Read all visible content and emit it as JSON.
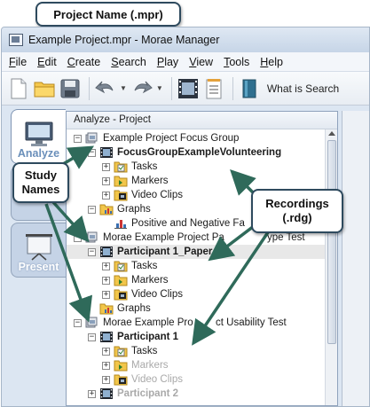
{
  "callouts": {
    "project_name": "Project Name (.mpr)",
    "study_names": [
      "Study",
      "Names"
    ],
    "recordings": [
      "Recordings",
      "(.rdg)"
    ]
  },
  "window": {
    "title": "Example Project.mpr - Morae Manager"
  },
  "menu": [
    "File",
    "Edit",
    "Create",
    "Search",
    "Play",
    "View",
    "Tools",
    "Help"
  ],
  "toolbar": {
    "icons": [
      "new-file-icon",
      "open-folder-icon",
      "save-icon",
      "undo-icon",
      "redo-icon",
      "video-icon",
      "notes-icon",
      "search-book-icon"
    ],
    "search_label": "What is Search"
  },
  "tabs": {
    "analyze": "Analyze",
    "present": "Present"
  },
  "panel": {
    "title": "Analyze - Project"
  },
  "tree": [
    {
      "label": "Example Project Focus Group",
      "type": "study",
      "expander": "−",
      "level": 0
    },
    {
      "label": "FocusGroupExampleVolunteering",
      "type": "recording",
      "expander": "−",
      "level": 1,
      "bold": true
    },
    {
      "label": "Tasks",
      "type": "tasks",
      "expander": "+",
      "level": 2
    },
    {
      "label": "Markers",
      "type": "markers",
      "expander": "+",
      "level": 2
    },
    {
      "label": "Video Clips",
      "type": "clips",
      "expander": "+",
      "level": 2
    },
    {
      "label": "Graphs",
      "type": "graphs",
      "expander": "−",
      "level": 1
    },
    {
      "label": "Positive and Negative Fa",
      "type": "graph",
      "expander": "",
      "level": 2
    },
    {
      "label": "Morae Example Project Pa",
      "type": "study",
      "expander": "−",
      "level": 0
    },
    {
      "label": "Participant 1_Paper",
      "type": "recording",
      "expander": "−",
      "level": 1,
      "bold": true,
      "selected": true
    },
    {
      "label": "Tasks",
      "type": "tasks",
      "expander": "+",
      "level": 2
    },
    {
      "label": "Markers",
      "type": "markers",
      "expander": "+",
      "level": 2
    },
    {
      "label": "Video Clips",
      "type": "clips",
      "expander": "+",
      "level": 2
    },
    {
      "label": "Graphs",
      "type": "graphs",
      "expander": "",
      "level": 1
    },
    {
      "label": "Morae Example Pro",
      "type": "study",
      "expander": "−",
      "level": 0
    },
    {
      "label": "Participant 1",
      "type": "recording",
      "expander": "−",
      "level": 1,
      "bold": true
    },
    {
      "label": "Tasks",
      "type": "tasks",
      "expander": "+",
      "level": 2
    },
    {
      "label": "Markers",
      "type": "markers",
      "expander": "+",
      "level": 2,
      "faded": true
    },
    {
      "label": "Video Clips",
      "type": "clips",
      "expander": "+",
      "level": 2,
      "faded": true
    },
    {
      "label": "Participant 2",
      "type": "recording",
      "expander": "+",
      "level": 1,
      "bold": true,
      "faded": true
    }
  ],
  "overlay_text": [
    {
      "text": "ype Test",
      "row": 7
    },
    {
      "text": "ct Usability Test",
      "row": 13
    }
  ],
  "colors": {
    "callout_border": "#2e4a5e",
    "arrow": "#2f6a5a",
    "tab_label": "#6a8fba"
  }
}
